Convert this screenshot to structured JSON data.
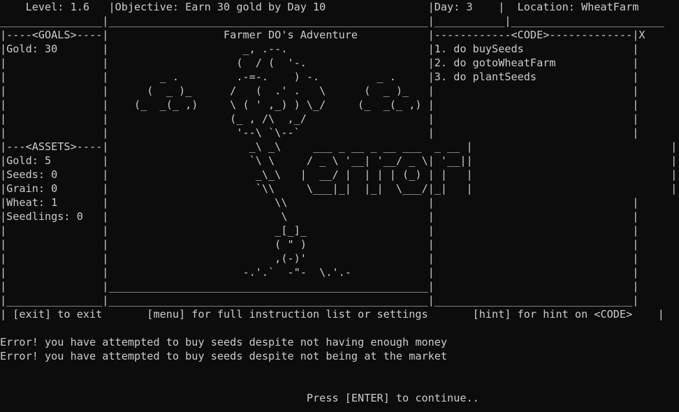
{
  "terminal": {
    "background": "#0c0c0c",
    "foreground": "#cccccc",
    "lines": [
      "    Level: 1.6   |Objective: Earn 30 gold by Day 10                |Day: 3    |  Location: WheatFarm",
      "________________|__________________________________________________|___________|________________________",
      "|----<GOALS>----|                  Farmer DO's Adventure           |------------<CODE>-------------|X",
      "|Gold: 30       |                     _, .--.                      |1. do buySeeds                 |",
      "|               |                    (  / (  '-.                   |2. do gotoWheatFarm            |",
      "|               |        _ .         .-=-.    ) -.         _ .     |3. do plantSeeds               |",
      "|               |      (  _ )_      /   (  .' .   \\      (  _ )_   |                               |",
      "|               |    (_  _(_ ,)     \\ ( ' ,_) ) \\_/     (_  _(_ ,) |                               |",
      "|               |                   (_ , /\\  ,_/                   |                               |",
      "|               |                    '--\\ `\\--`                    |                               |",
      "|---<ASSETS>----|                      _\\ _\\     ___ _ __ _ __ ___  _ __ |                               |",
      "|Gold: 5        |                      `\\ \\     / _ \\ '__| '__/ _ \\| '__||                               |",
      "|Seeds: 0       |                       _\\_\\   |  __/ |  | | | (_) | |   |                               |",
      "|Grain: 0       |                       `\\\\     \\___|_|  |_|  \\___/|_|   |                               |",
      "|Wheat: 1       |                          \\\\                      |                               |",
      "|Seedlings: 0   |                           \\                      |                               |",
      "|               |                          _[_]_                   |                               |",
      "|               |                          ( \" )                   |                               |",
      "|               |                          ,(-)'                   |                               |",
      "|               |                     -.'.`  -\"-  \\.'.-            |                               |",
      "|               |__________________________________________________|                               |",
      "|_______________|__________________________________________________|_______________________________|",
      "| [exit] to exit       [menu] for full instruction list or settings       [hint] for hint on <CODE>    |",
      "",
      "Error! you have attempted to buy seeds despite not having enough money",
      "Error! you have attempted to buy seeds despite not being at the market",
      "",
      "",
      "                                                Press [ENTER] to continue.."
    ]
  }
}
